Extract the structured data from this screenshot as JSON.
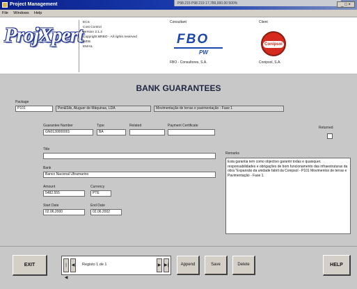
{
  "window": {
    "title": "Project Management",
    "background_snippet": "P98.215  P98  219  17,789,000.00  500%"
  },
  "menu": [
    "File",
    "Windows",
    "Help"
  ],
  "header": {
    "logo_text": "ProjXpert",
    "info_lines": [
      "ECS",
      "Cost Control",
      "Version 2.1.2",
      "Copyright BRBO - All rights reserved",
      "WEB",
      "EMAIL"
    ],
    "consultant_label": "Consultant",
    "consultant_name": "FBO - Consultores, S.A.",
    "consultant_logo": "FBO",
    "consultant_logo_sub": "PW",
    "client_label": "Client",
    "client_name": "Conipsol, S.A.",
    "client_logo": "Conipsol"
  },
  "form": {
    "heading": "BANK GUARANTEES",
    "package_label": "Package",
    "package_code": "P101",
    "package_company": "Pen&Sils, Aluguer de Máquinas, LDA",
    "package_desc": "Movimentação de terras e pavimentação - Fase 1",
    "guarantee_number_label": "Guarantee Number",
    "guarantee_number": "GN0130000001",
    "type_label": "Type",
    "type": "BA",
    "related_label": "Related",
    "related": "",
    "payment_cert_label": "Payment Certificate",
    "payment_cert": "",
    "returned_label": "Returned",
    "title_label": "Title",
    "title": "",
    "bank_label": "Bank",
    "bank": "Banco Nacional Ultramarino",
    "amount_label": "Amount",
    "amount": "5482.555",
    "currency_label": "Currency",
    "currency": "PTE",
    "start_date_label": "Start Date",
    "start_date": "02.06.2000",
    "end_date_label": "End Date",
    "end_date": "02.06.2002",
    "remarks_label": "Remarks",
    "remarks": "Esta garantia tem como objectivo garantir todas e quaisquer, responsabilidades e obrigações de bom funcionamento das infraestruturas da obra \"Expansão da unidade fabril da Conipsol - P101 Movimentos de terras e Pavimentação - Fase 1."
  },
  "footer": {
    "exit": "EXIT",
    "nav_first": "|◀",
    "nav_prev": "◀",
    "nav_record": "Registo 1 de 1",
    "nav_next": "▶",
    "nav_last": "▶|",
    "append": "Append",
    "save": "Save",
    "delete": "Delete",
    "help": "HELP"
  },
  "colors": {
    "title_bar": "#0a1f8a",
    "form_bg": "#c8c8c8",
    "heading": "#1f2540",
    "fpo_blue": "#1b47a8",
    "client_red": "#d52b1e"
  }
}
